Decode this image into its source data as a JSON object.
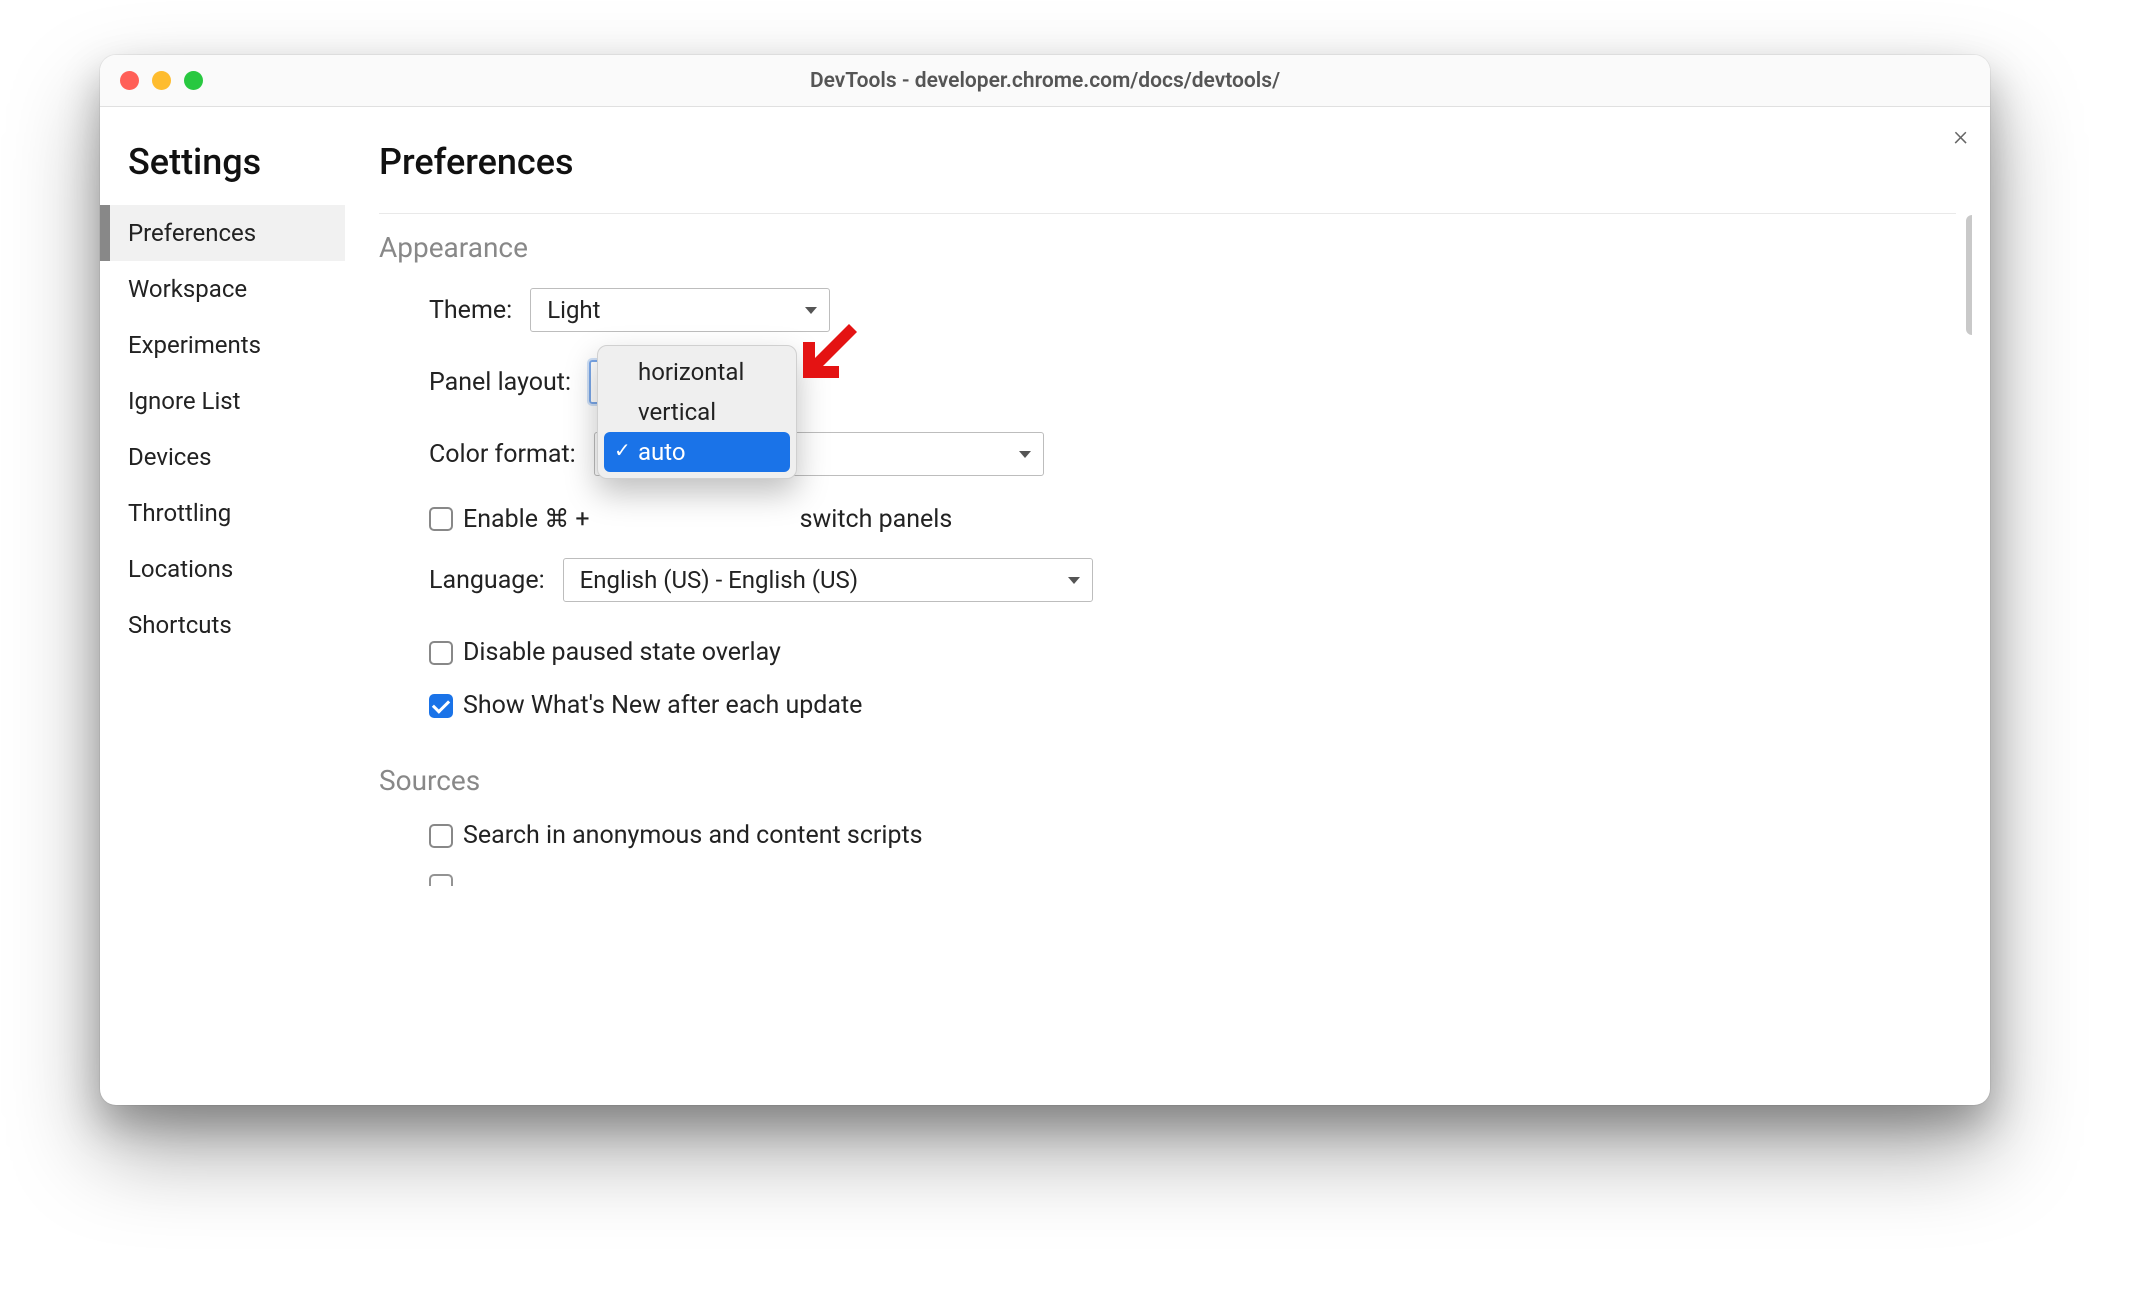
{
  "window": {
    "title": "DevTools - developer.chrome.com/docs/devtools/"
  },
  "sidebar": {
    "title": "Settings",
    "items": [
      {
        "label": "Preferences",
        "active": true
      },
      {
        "label": "Workspace",
        "active": false
      },
      {
        "label": "Experiments",
        "active": false
      },
      {
        "label": "Ignore List",
        "active": false
      },
      {
        "label": "Devices",
        "active": false
      },
      {
        "label": "Throttling",
        "active": false
      },
      {
        "label": "Locations",
        "active": false
      },
      {
        "label": "Shortcuts",
        "active": false
      }
    ]
  },
  "main": {
    "title": "Preferences",
    "sections": {
      "appearance": {
        "heading": "Appearance",
        "theme": {
          "label": "Theme:",
          "value": "Light"
        },
        "panel_layout": {
          "label": "Panel layout:",
          "value": "auto",
          "options": [
            {
              "label": "horizontal",
              "selected": false
            },
            {
              "label": "vertical",
              "selected": false
            },
            {
              "label": "auto",
              "selected": true
            }
          ]
        },
        "color_format": {
          "label": "Color format:",
          "value": ""
        },
        "enable_shortcut": {
          "text_before": "Enable ⌘ + ",
          "text_after": " switch panels",
          "checked": false
        },
        "language": {
          "label": "Language:",
          "value": "English (US) - English (US)"
        },
        "disable_paused_overlay": {
          "label": "Disable paused state overlay",
          "checked": false
        },
        "show_whats_new": {
          "label": "Show What's New after each update",
          "checked": true
        }
      },
      "sources": {
        "heading": "Sources",
        "search_anon": {
          "label": "Search in anonymous and content scripts",
          "checked": false
        }
      }
    }
  },
  "annotation": {
    "arrow_color": "#e41313"
  }
}
